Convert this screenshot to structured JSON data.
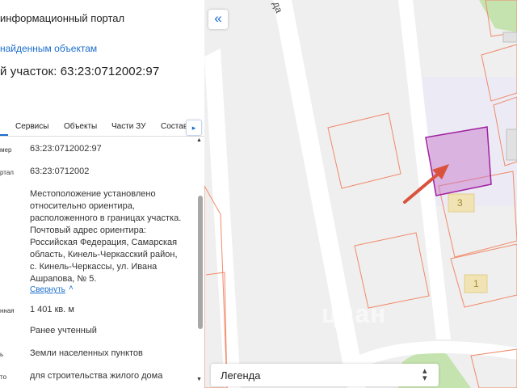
{
  "header": {
    "portal_title": "информационный портал",
    "back_link": "найденным объектам",
    "plot_title": "й участок: 63:23:0712002:97"
  },
  "tabs": [
    {
      "label": "Сервисы"
    },
    {
      "label": "Объекты"
    },
    {
      "label": "Части ЗУ"
    },
    {
      "label": "Состав"
    }
  ],
  "tabs_next_label": "▸",
  "details": {
    "rows": [
      {
        "key": "мер",
        "value": "63:23:0712002:97"
      },
      {
        "key": "ртал",
        "value": "63:23:0712002"
      },
      {
        "key": "",
        "value": "Местоположение установлено\nотносительно ориентира,\nрасположенного в границах участка.\nПочтовый адрес ориентира:\nРоссийская Федерация, Самарская\nобласть, Кинель-Черкасский район,\nс. Кинель-Черкассы, ул. Ивана\nАшрапова, № 5."
      },
      {
        "key": "нная",
        "value": "1 401 кв. м"
      },
      {
        "key": "",
        "value": "Ранее учтенный"
      },
      {
        "key": "ь",
        "value": "Земли населенных пунктов"
      },
      {
        "key": "то",
        "value": "для строительства жилого дома"
      }
    ],
    "collapse_label": "Свернуть",
    "collapse_icon": "chevron-up"
  },
  "map": {
    "collapse_button": "«",
    "street_label": "да",
    "house_numbers": [
      "3",
      "1"
    ],
    "watermark": "циан",
    "legend_label": "Легенда",
    "legend_arrow": "▴▾",
    "selected_color": "#a020a0",
    "parcel_color": "#f08a6a"
  }
}
